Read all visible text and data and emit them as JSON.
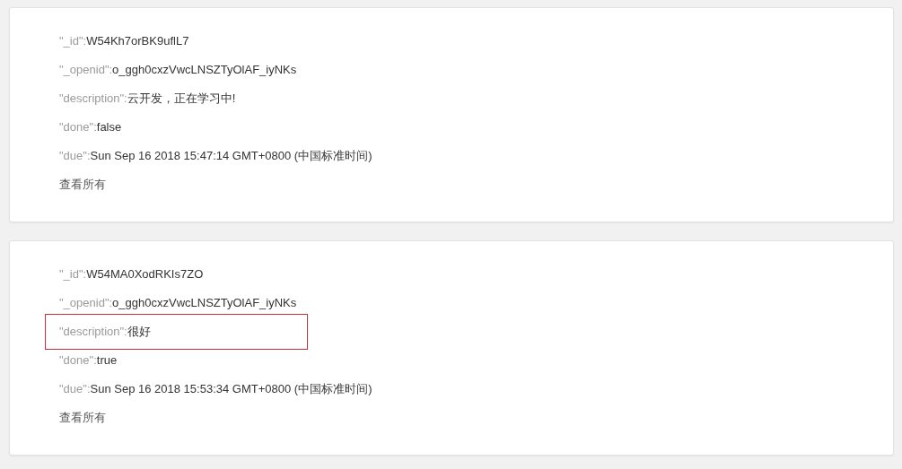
{
  "records": [
    {
      "fields": [
        {
          "key": "\"_id\":",
          "value": "W54Kh7orBK9uflL7",
          "highlighted": false
        },
        {
          "key": "\"_openid\":",
          "value": "o_ggh0cxzVwcLNSZTyOlAF_iyNKs",
          "highlighted": false
        },
        {
          "key": "\"description\":",
          "value": "云开发，正在学习中!",
          "highlighted": false
        },
        {
          "key": "\"done\":",
          "value": "false",
          "highlighted": false
        },
        {
          "key": "\"due\":",
          "value": "Sun Sep 16 2018 15:47:14 GMT+0800 (中国标准时间)",
          "highlighted": false
        }
      ],
      "link": "查看所有"
    },
    {
      "fields": [
        {
          "key": "\"_id\":",
          "value": "W54MA0XodRKIs7ZO",
          "highlighted": false
        },
        {
          "key": "\"_openid\":",
          "value": "o_ggh0cxzVwcLNSZTyOlAF_iyNKs",
          "highlighted": false
        },
        {
          "key": "\"description\":",
          "value": "很好",
          "highlighted": true
        },
        {
          "key": "\"done\":",
          "value": "true",
          "highlighted": false
        },
        {
          "key": "\"due\":",
          "value": "Sun Sep 16 2018 15:53:34 GMT+0800 (中国标准时间)",
          "highlighted": false
        }
      ],
      "link": "查看所有"
    }
  ]
}
